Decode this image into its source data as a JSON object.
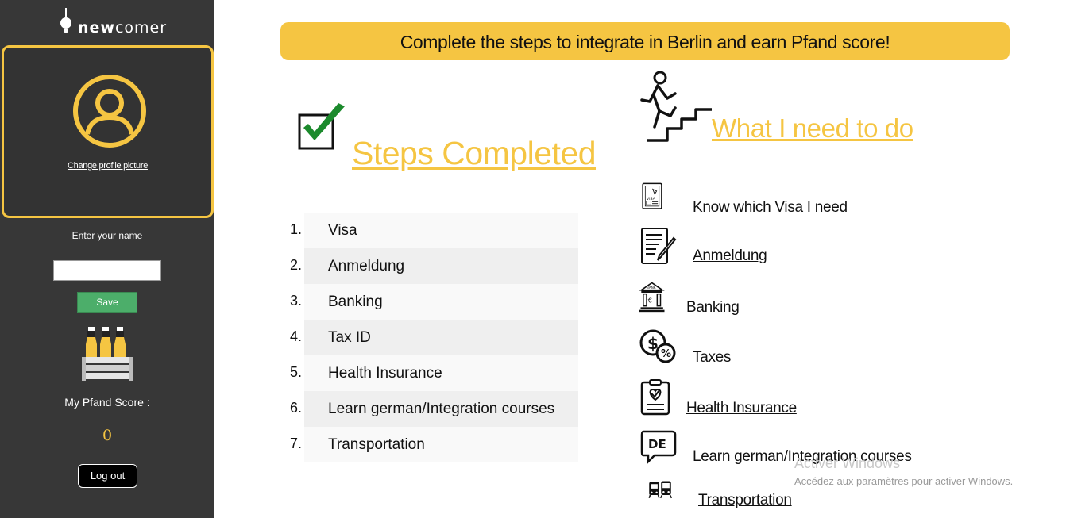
{
  "sidebar": {
    "logo_text_bold": "new",
    "logo_text": "comer",
    "change_picture": "Change profile picture",
    "enter_name_label": "Enter your name",
    "name_input_value": "",
    "save_label": "Save",
    "pfand_label": "My Pfand Score :",
    "pfand_score": "0",
    "logout_label": "Log out"
  },
  "banner": {
    "text": "Complete the steps to integrate in Berlin and earn Pfand score!"
  },
  "steps_completed": {
    "title": "Steps Completed",
    "items": [
      {
        "num": "1.",
        "label": "Visa"
      },
      {
        "num": "2.",
        "label": "Anmeldung"
      },
      {
        "num": "3.",
        "label": "Banking"
      },
      {
        "num": "4.",
        "label": "Tax ID"
      },
      {
        "num": "5.",
        "label": "Health Insurance"
      },
      {
        "num": "6.",
        "label": "Learn german/Integration courses"
      },
      {
        "num": "7.",
        "label": "Transportation"
      }
    ]
  },
  "todo": {
    "title": "What I need to do",
    "items": [
      {
        "label": "Know which Visa I need",
        "icon": "visa-document-icon"
      },
      {
        "label": "Anmeldung",
        "icon": "form-document-icon"
      },
      {
        "label": "Banking",
        "icon": "bank-icon"
      },
      {
        "label": "Taxes",
        "icon": "tax-coins-icon"
      },
      {
        "label": "Health Insurance",
        "icon": "clipboard-heart-icon"
      },
      {
        "label": "Learn german/Integration courses",
        "icon": "de-speech-bubble-icon"
      },
      {
        "label": "Transportation",
        "icon": "bus-train-icon"
      }
    ]
  },
  "watermark": {
    "title": "Activer Windows",
    "subtitle": "Accédez aux paramètres pour activer Windows."
  },
  "colors": {
    "accent": "#f5c542",
    "sidebar_bg": "#373737",
    "save_green": "#4cae6a"
  }
}
